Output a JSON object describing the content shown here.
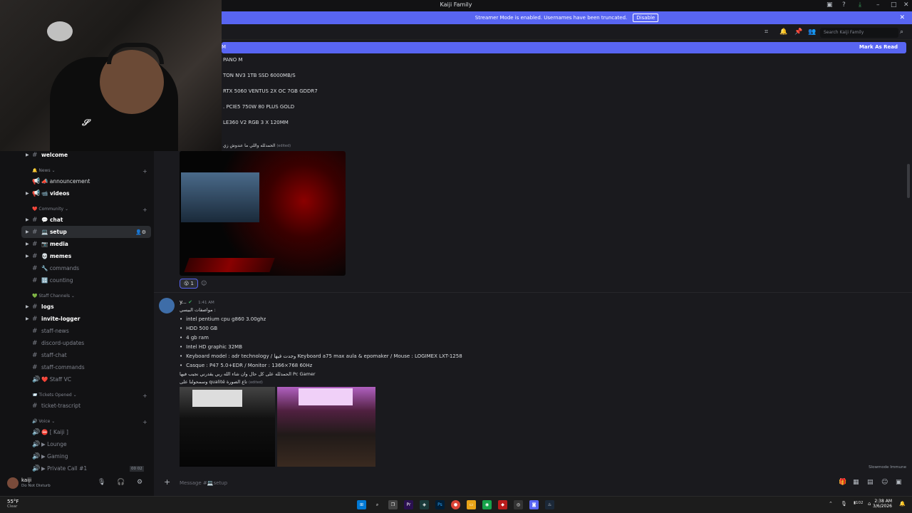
{
  "window": {
    "title": "Kaiji Family"
  },
  "banner": {
    "text": "Streamer Mode is enabled. Usernames have been truncated.",
    "button": "Disable"
  },
  "search": {
    "placeholder": "Search Kaiji Family"
  },
  "new_messages": {
    "left": "M",
    "mark_read": "Mark As Read"
  },
  "specs_top": [
    "PANO M",
    "TON NV3 1TB SSD 6000MB/S",
    "RTX 5060 VENTUS 2X OC 7GB GDDR7",
    ". PCIE5 750W 80 PLUS GOLD",
    "LE360 V2 RGB 3 X 120MM"
  ],
  "arabic_top": {
    "text": "الحمدلله واللي ما عندوش زي",
    "edited": "(edited)"
  },
  "reaction": {
    "count": "1"
  },
  "sidebar": {
    "channels": [
      {
        "name": "welcome",
        "style": "unread"
      },
      {
        "name": "📣 announcement",
        "style": "normal"
      },
      {
        "name": "📹 videos",
        "style": "unread"
      },
      {
        "name": "💬 chat",
        "style": "unread"
      },
      {
        "name": "💻 setup",
        "style": "selected"
      },
      {
        "name": "📷 media",
        "style": "unread"
      },
      {
        "name": "💀 memes",
        "style": "unread"
      },
      {
        "name": "🔧 commands",
        "style": "dim"
      },
      {
        "name": "🔢 counting",
        "style": "dim"
      },
      {
        "name": "logs",
        "style": "unread"
      },
      {
        "name": "invite-logger",
        "style": "unread"
      },
      {
        "name": "staff-news",
        "style": "dim"
      },
      {
        "name": "discord-updates",
        "style": "dim"
      },
      {
        "name": "staff-chat",
        "style": "dim"
      },
      {
        "name": "staff-commands",
        "style": "dim"
      },
      {
        "name": "❤️ Staff VC",
        "style": "dim"
      },
      {
        "name": "ticket-trascript",
        "style": "dim"
      },
      {
        "name": "⛔ [ Kaiji ]",
        "style": "dim"
      },
      {
        "name": "▶ Lounge",
        "style": "dim"
      },
      {
        "name": "▶ Gaming",
        "style": "dim"
      },
      {
        "name": "▶ Private Call #1",
        "style": "dim"
      }
    ],
    "categories": [
      "🔔 News",
      "❤️ Community",
      "💚 Staff Channels",
      "📨 Tickets Opened",
      "🔊 Voice"
    ],
    "voice_badge": "00 02"
  },
  "user": {
    "name": "kaiji",
    "status": "Do Not Disturb"
  },
  "message": {
    "author": "y...",
    "time": "1:41 AM",
    "intro": "مواصفات البيسي :",
    "bullets": [
      "intel pentium cpu g860 3.00ghz",
      "HDD 500 GB",
      "4 gb ram",
      "Intel HD graphic 32MB",
      "Keyboard model : adr technology / وجدت فيها Keyboard a75 max aula & epomaker / Mouse : LOGIMEX LXT-1258",
      "Casque : P47 5.0+EDR / Monitor : 1366×768 60Hz"
    ],
    "line1": "الحمدلله على كل حال وان شاء الله ربي يقدرني نجيب فيها Pc Gamer",
    "line2": "وسمحولنا على qualité تاع الصورة",
    "edited": "(edited)"
  },
  "slowmode": "Slowmode Immune",
  "composer": {
    "placeholder": "Message #💻setup"
  },
  "taskbar": {
    "temp": "55°F",
    "cond": "Clear",
    "time": "2:38 AM",
    "date": "3/6/2026",
    "battery": "102"
  }
}
